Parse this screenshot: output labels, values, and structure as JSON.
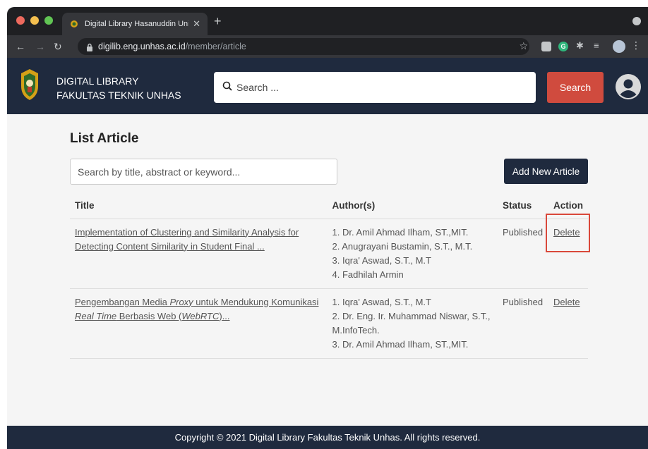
{
  "browser": {
    "tab_title": "Digital Library Hasanuddin Uni",
    "tab_close": "✕",
    "new_tab": "+",
    "url_host": "digilib.eng.unhas.ac.id",
    "url_path": "/member/article"
  },
  "header": {
    "brand_line1": "DIGITAL LIBRARY",
    "brand_line2": "FAKULTAS TEKNIK UNHAS",
    "search_placeholder": "Search ...",
    "search_button": "Search"
  },
  "main": {
    "title": "List Article",
    "search_placeholder": "Search by title, abstract or keyword...",
    "add_button": "Add New Article",
    "columns": {
      "title": "Title",
      "authors": "Author(s)",
      "status": "Status",
      "action": "Action"
    },
    "rows": [
      {
        "title_line1": "Implementation of Clustering and Similarity Analysis for",
        "title_line2": "Detecting Content Similarity in Student Final ...",
        "authors": [
          "1. Dr. Amil Ahmad Ilham, ST.,MIT.",
          "2. Anugrayani Bustamin, S.T., M.T.",
          "3. Iqra' Aswad, S.T., M.T",
          "4. Fadhilah Armin"
        ],
        "status": "Published",
        "action": "Delete"
      },
      {
        "title_parts": {
          "p1": "Pengembangan Media ",
          "p2": "Proxy",
          "p3": " untuk Mendukung Komunikasi",
          "p4": "Real Time",
          "p5": " Berbasis Web (",
          "p6": "WebRTC",
          "p7": ")..."
        },
        "authors": [
          "1. Iqra' Aswad, S.T., M.T",
          "2. Dr. Eng. Ir. Muhammad Niswar, S.T.,",
          "M.InfoTech.",
          "3. Dr. Amil Ahmad Ilham, ST.,MIT."
        ],
        "status": "Published",
        "action": "Delete"
      }
    ]
  },
  "footer": {
    "text": "Copyright © 2021 Digital Library Fakultas Teknik Unhas. All rights reserved."
  },
  "colors": {
    "header_bg": "#1f2a3e",
    "search_button": "#d04b3e",
    "highlight": "#d9483a"
  }
}
